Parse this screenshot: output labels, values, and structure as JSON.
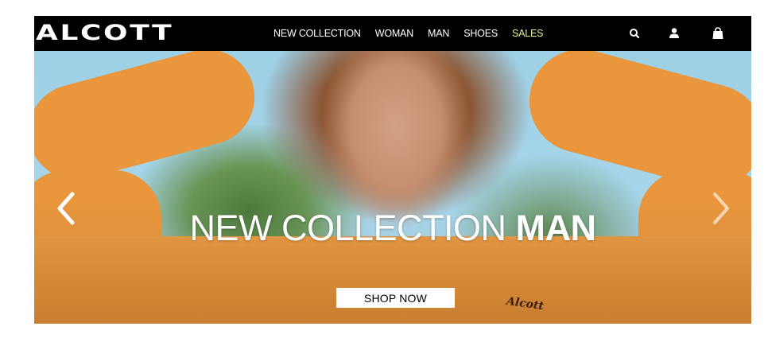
{
  "brand": {
    "logo_text": "ALCOTT"
  },
  "nav": {
    "items": [
      {
        "label": "NEW COLLECTION",
        "key": "new-collection"
      },
      {
        "label": "WOMAN",
        "key": "woman"
      },
      {
        "label": "MAN",
        "key": "man"
      },
      {
        "label": "SHOES",
        "key": "shoes"
      },
      {
        "label": "SALES",
        "key": "sales",
        "color": "#e4f08a"
      }
    ]
  },
  "header_icons": [
    "search-icon",
    "user-icon",
    "bag-icon"
  ],
  "hero": {
    "title_light": "NEW COLLECTION",
    "title_bold": "MAN",
    "cta_label": "SHOP NOW",
    "prev_icon": "chevron-left-icon",
    "next_icon": "chevron-right-icon"
  },
  "colors": {
    "header_bg": "#000000",
    "sales_accent": "#e4f08a",
    "sweater_orange": "#e9963d"
  }
}
